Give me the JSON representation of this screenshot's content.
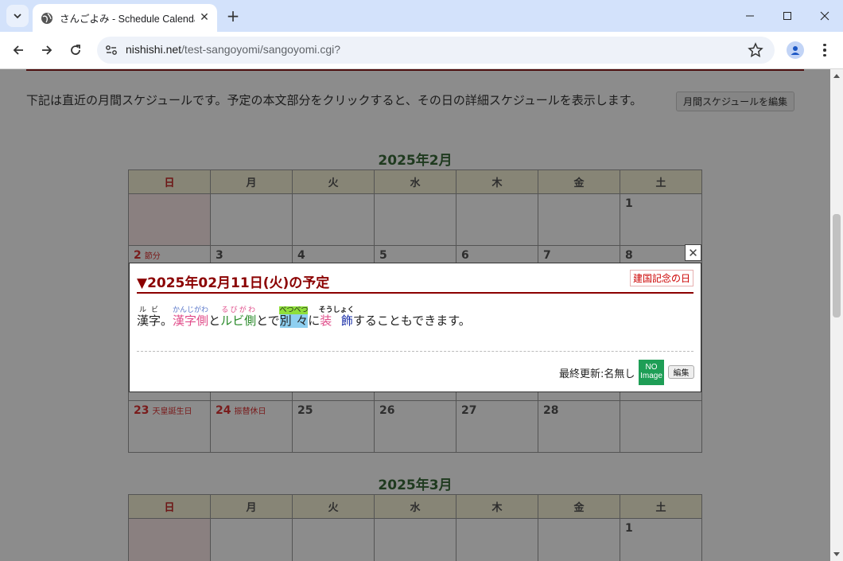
{
  "browser": {
    "tab_title": "さんごよみ - Schedule Calendar -",
    "url_host": "nishishi.net",
    "url_path": "/test-sangoyomi/sangoyomi.cgi?"
  },
  "page": {
    "intro": "下記は直近の月間スケジュールです。予定の本文部分をクリックすると、その日の詳細スケジュールを表示します。",
    "edit_month_label": "月間スケジュールを編集",
    "weekdays": [
      "日",
      "月",
      "火",
      "水",
      "木",
      "金",
      "土"
    ],
    "feb": {
      "title": "2025年2月",
      "row1": [
        "",
        "",
        "",
        "",
        "",
        "",
        "1"
      ],
      "row2": [
        "2",
        "3",
        "4",
        "5",
        "6",
        "7",
        "8"
      ],
      "row2_holiday": "節分",
      "row_last": [
        "23",
        "24",
        "25",
        "26",
        "27",
        "28",
        ""
      ],
      "row_last_holidays": [
        "天皇誕生日",
        "振替休日"
      ]
    },
    "mar": {
      "title": "2025年3月",
      "row1": [
        "",
        "",
        "",
        "",
        "",
        "",
        "1"
      ]
    }
  },
  "modal": {
    "heading": "▼2025年02月11日(火)の予定",
    "holiday_badge": "建国記念の日",
    "text": {
      "kanji1": "漢",
      "kanji1_rt": "ル",
      "kanji2": "字",
      "kanji2_rt": "ビ",
      "punct": "。",
      "ruby2": "漢字側",
      "ruby2_rt": "かんじがわ",
      "to1": "と",
      "ruby3": "ルビ側",
      "ruby3_rt": "るびがわ",
      "tode": "とで",
      "ruby4": "別 々",
      "ruby4_rt": "べつべつ",
      "ni": "に",
      "ruby5a": "装 ",
      "ruby6": "飾",
      "ruby56_rt": "そうしょく",
      "tail": "することもできます。"
    },
    "footer_label": "最終更新:名無し",
    "noimage_line1": "NO",
    "noimage_line2": "Image",
    "edit_label": "編集",
    "close_glyph": "✕"
  }
}
